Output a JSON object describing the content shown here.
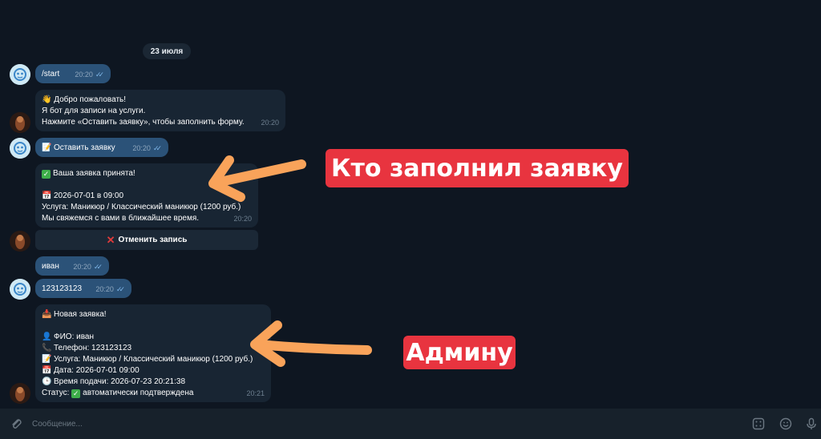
{
  "date_label": "23 июля",
  "messages": [
    {
      "text": "/start",
      "time": "20:20"
    },
    {
      "lines": [
        "👋 Добро пожаловать!",
        "Я бот для записи на услуги.",
        "Нажмите «Оставить заявку», чтобы заполнить форму."
      ],
      "time": "20:20"
    },
    {
      "text": "Оставить заявку",
      "time": "20:20"
    },
    {
      "lines": [
        "Ваша заявка принята!",
        "",
        "2026-07-01 в 09:00",
        "Услуга: Маникюр / Классический маникюр (1200 руб.)",
        "Мы свяжемся с вами в ближайшее время."
      ],
      "time": "20:20"
    },
    {
      "text": "иван",
      "time": "20:20"
    },
    {
      "text": "123123123",
      "time": "20:20"
    },
    {
      "lines": [
        "Новая заявка!",
        "",
        "ФИО: иван",
        "Телефон: 123123123",
        "Услуга: Маникюр / Классический маникюр (1200 руб.)",
        "Дата: 2026-07-01 09:00",
        "Время подачи: 2026-07-23 20:21:38",
        "Статус:",
        "автоматически подтверждена"
      ],
      "time": "20:21"
    }
  ],
  "inline_button": {
    "label": "Отменить запись",
    "icon": "cross-mark-icon"
  },
  "callouts": [
    {
      "text": "Кто заполнил заявку",
      "color": "#e8343f"
    },
    {
      "text": "Админу",
      "color": "#e8343f"
    }
  ],
  "arrow_color": "#f9a35a",
  "composer": {
    "placeholder": "Сообщение..."
  },
  "colors": {
    "background": "#0e1621",
    "outgoing_bubble": "#2b5278",
    "incoming_bubble": "#182533",
    "composer": "#17212b"
  }
}
